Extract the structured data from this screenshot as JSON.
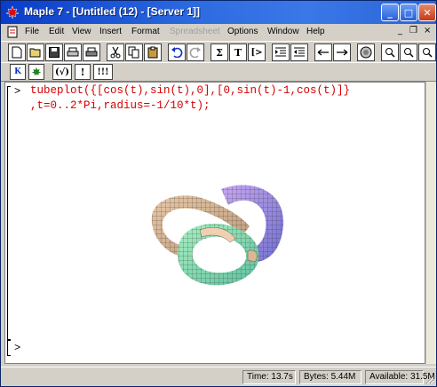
{
  "window": {
    "title": "Maple 7 - [Untitled (12) - [Server 1]]",
    "controls": {
      "minimize": "_",
      "maximize": "□",
      "close": "✕"
    }
  },
  "menu": {
    "items": [
      {
        "label": "File",
        "enabled": true
      },
      {
        "label": "Edit",
        "enabled": true
      },
      {
        "label": "View",
        "enabled": true
      },
      {
        "label": "Insert",
        "enabled": true
      },
      {
        "label": "Format",
        "enabled": true
      },
      {
        "label": "Spreadsheet",
        "enabled": false
      },
      {
        "label": "Options",
        "enabled": true
      },
      {
        "label": "Window",
        "enabled": true
      },
      {
        "label": "Help",
        "enabled": true
      }
    ],
    "mdi_controls": {
      "minimize": "_",
      "restore": "❐",
      "close": "×"
    }
  },
  "toolbar": {
    "sigma_label": "Σ",
    "text_label": "T",
    "input_label": "[>"
  },
  "context_bar": {
    "kernel_label": "K",
    "check_label": "(√)",
    "exec_label": "!",
    "exec_all_label": "!!!"
  },
  "worksheet": {
    "prompt": ">",
    "command_line1": "tubeplot({[cos(t),sin(t),0],[0,sin(t)-1,cos(t)]}",
    "command_line2": ",t=0..2*Pi,radius=-1/10*t);",
    "empty_prompt": "[>"
  },
  "status": {
    "time": "Time: 13.7s",
    "bytes": "Bytes: 5.44M",
    "available": "Available: 31.5M"
  },
  "colors": {
    "title_bar": "#2d6be0",
    "command_text": "#d40000",
    "chrome": "#d4d0c8"
  }
}
